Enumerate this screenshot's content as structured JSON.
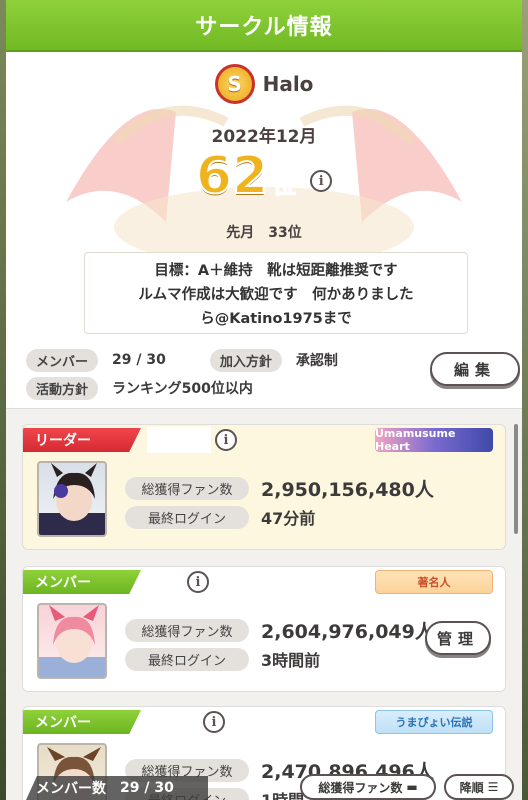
{
  "header": {
    "title": "サークル情報"
  },
  "circle": {
    "emblem_letter": "S",
    "name": "Halo",
    "month": "2022年12月",
    "rank": "62",
    "rank_unit": "位",
    "prev_label": "先月",
    "prev_rank": "33位",
    "goal_lines": [
      "目標：A＋維持　靴は短距離推奨です",
      "ルムマ作成は大歓迎です　何かありました",
      "ら@Katino1975まで"
    ],
    "members_label": "メンバー",
    "members_value": "29 / 30",
    "join_label": "加入方針",
    "join_value": "承認制",
    "policy_label": "活動方針",
    "policy_value": "ランキング500位以内",
    "edit_label": "編集"
  },
  "members": [
    {
      "role": "リーダー",
      "badge": "Umamusume Heart",
      "fans_label": "総獲得ファン数",
      "fans": "2,950,156,480人",
      "login_label": "最終ログイン",
      "login": "47分前"
    },
    {
      "role": "メンバー",
      "badge": "著名人",
      "fans_label": "総獲得ファン数",
      "fans": "2,604,976,049人",
      "login_label": "最終ログイン",
      "login": "3時間前",
      "manage_label": "管理"
    },
    {
      "role": "メンバー",
      "badge": "うまぴょい伝説",
      "fans_label": "総獲得ファン数",
      "fans": "2,470,896,496人",
      "login_label": "最終ログイン",
      "login": "1時間"
    }
  ],
  "footer": {
    "count_label": "メンバー数",
    "count_value": "29 / 30",
    "sort_label": "総獲得ファン数",
    "order_label": "降順"
  },
  "colors": {
    "header": "#7fc52e",
    "leader": "#e0353c",
    "member": "#7fc52e",
    "rank": "#f0b320"
  }
}
